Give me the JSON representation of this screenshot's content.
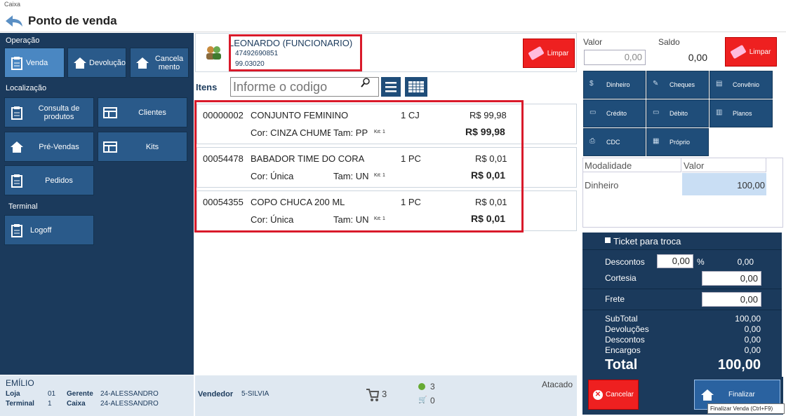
{
  "window": {
    "title": "Caixa"
  },
  "header": {
    "title": "Ponto de venda"
  },
  "sidebar": {
    "operacao_label": "Operação",
    "venda": "Venda",
    "devolucao": "Devolução",
    "cancelamento": "Cancela mento",
    "localizacao_label": "Localização",
    "consulta": "Consulta de produtos",
    "clientes": "Clientes",
    "prevendas": "Pré-Vendas",
    "kits": "Kits",
    "pedidos": "Pedidos",
    "terminal_label": "Terminal",
    "logoff": "Logoff"
  },
  "footer": {
    "user": "EMÍLIO",
    "loja_label": "Loja",
    "loja": "01",
    "gerente_label": "Gerente",
    "gerente": "24-ALESSANDRO",
    "terminal_label": "Terminal",
    "terminal": "1",
    "caixa_label": "Caixa",
    "caixa": "24-ALESSANDRO",
    "vendedor_label": "Vendedor",
    "vendedor": "5-SILVIA",
    "cart_count": "3",
    "ok_count": "3",
    "cart2_count": "0",
    "atacado": "Atacado"
  },
  "customer": {
    "name": "LEONARDO (FUNCIONARIO)",
    "phone": "47492690851",
    "code": "99.03020",
    "clear_label": "Limpar"
  },
  "items": {
    "label": "Itens",
    "search_placeholder": "Informe o codigo",
    "rows": [
      {
        "code": "00000002",
        "desc": "CONJUNTO FEMININO",
        "qty": "1 CJ",
        "unit": "R$ 99,98",
        "cor": "Cor: CINZA CHUME",
        "tam": "Tam: PP",
        "kit": "Kit: 1",
        "total": "R$ 99,98"
      },
      {
        "code": "00054478",
        "desc": "BABADOR TIME DO CORAÇ",
        "qty": "1 PC",
        "unit": "R$ 0,01",
        "cor": "Cor: Única",
        "tam": "Tam: UN",
        "kit": "Kit: 1",
        "total": "R$ 0,01"
      },
      {
        "code": "00054355",
        "desc": "COPO CHUCA 200 ML",
        "qty": "1 PC",
        "unit": "R$ 0,01",
        "cor": "Cor: Única",
        "tam": "Tam: UN",
        "kit": "Kit: 1",
        "total": "R$ 0,01"
      }
    ]
  },
  "payment": {
    "valor_label": "Valor",
    "valor": "0,00",
    "saldo_label": "Saldo",
    "saldo": "0,00",
    "clear_label": "Limpar",
    "methods": [
      "Dinheiro",
      "Cheques",
      "Convênio",
      "Crédito",
      "Débito",
      "Planos",
      "CDC",
      "Próprio"
    ],
    "table_head_mod": "Modalidade",
    "table_head_val": "Valor",
    "table_mod": "Dinheiro",
    "table_val": "100,00"
  },
  "totals": {
    "ticket_label": "Ticket para troca",
    "descontos_label": "Descontos",
    "descontos_pct": "0,00",
    "pct_sign": "%",
    "descontos_val": "0,00",
    "cortesia_label": "Cortesia",
    "cortesia": "0,00",
    "frete_label": "Frete",
    "frete": "0,00",
    "subtotal_label": "SubTotal",
    "subtotal": "100,00",
    "devolucoes_label": "Devoluções",
    "devolucoes": "0,00",
    "descontos2_label": "Descontos",
    "descontos2": "0,00",
    "encargos_label": "Encargos",
    "encargos": "0,00",
    "total_label": "Total",
    "total": "100,00",
    "cancel_label": "Cancelar",
    "finalize_label": "Finalizar",
    "tooltip": "Finalizar Venda (Ctrl+F9)"
  }
}
